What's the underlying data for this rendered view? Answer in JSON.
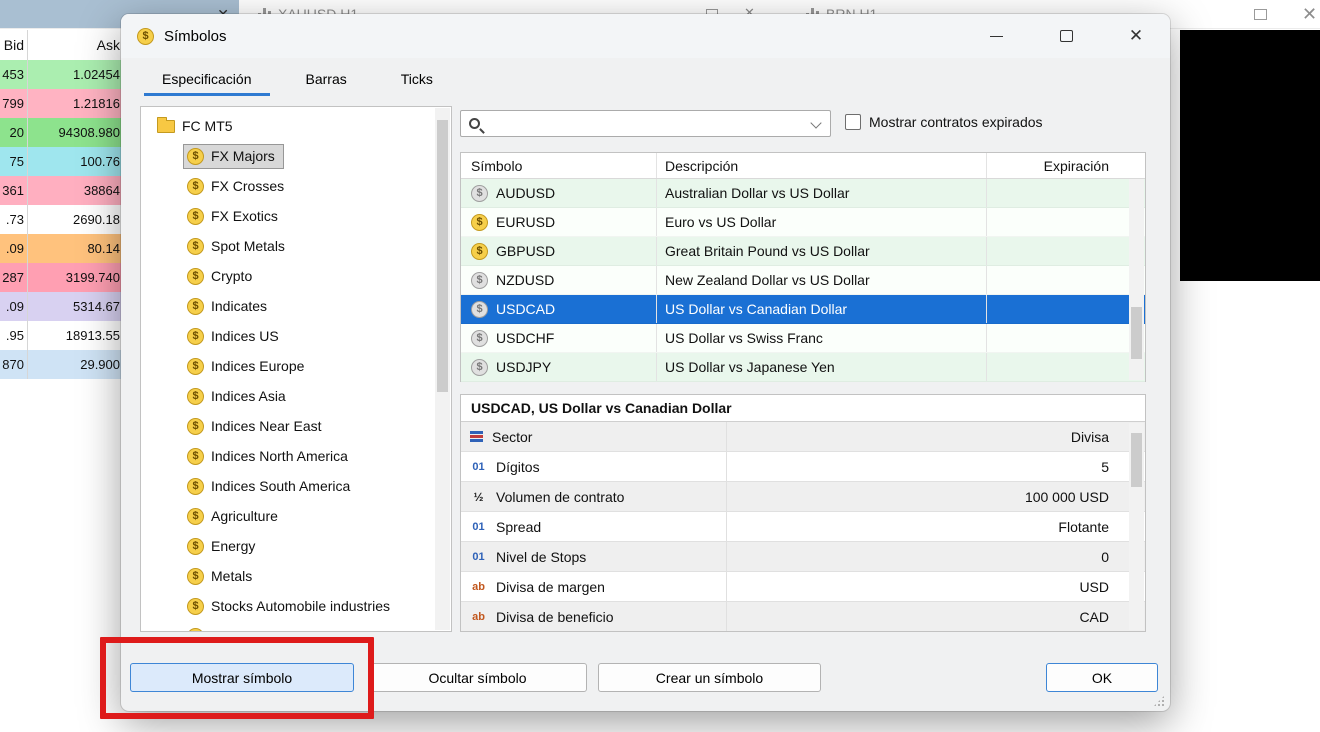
{
  "background": {
    "chart_tabs": [
      {
        "label": "XAUUSD,H1"
      },
      {
        "label": "BRN,H1"
      }
    ],
    "market_watch": {
      "headers": {
        "bid": "Bid",
        "ask": "Ask"
      },
      "rows": [
        {
          "bid": "453",
          "ask": "1.02454",
          "bg": "#abeeb0"
        },
        {
          "bid": "799",
          "ask": "1.21816",
          "bg": "#ffb3c2"
        },
        {
          "bid": "20",
          "ask": "94308.980",
          "bg": "#8de38d"
        },
        {
          "bid": "75",
          "ask": "100.76",
          "bg": "#9fe6ee"
        },
        {
          "bid": "361",
          "ask": "38864",
          "bg": "#ffafc0"
        },
        {
          "bid": ".73",
          "ask": "2690.18",
          "bg": "#ffffff"
        },
        {
          "bid": ".09",
          "ask": "80.14",
          "bg": "#ffc27d"
        },
        {
          "bid": "287",
          "ask": "3199.740",
          "bg": "#ff9fb2"
        },
        {
          "bid": ".09",
          "ask": "5314.67",
          "bg": "#d8d1f1"
        },
        {
          "bid": ".95",
          "ask": "18913.55",
          "bg": "#ffffff"
        },
        {
          "bid": "870",
          "ask": "29.900",
          "bg": "#cfe3f5"
        }
      ]
    }
  },
  "dialog": {
    "title": "Símbolos",
    "tabs": [
      {
        "label": "Especificación",
        "active": true
      },
      {
        "label": "Barras",
        "active": false
      },
      {
        "label": "Ticks",
        "active": false
      }
    ],
    "tree": {
      "root": {
        "label": "FC MT5"
      },
      "items": [
        {
          "label": "FX Majors",
          "selected": true
        },
        {
          "label": "FX Crosses",
          "selected": false
        },
        {
          "label": "FX Exotics",
          "selected": false
        },
        {
          "label": "Spot Metals",
          "selected": false
        },
        {
          "label": "Crypto",
          "selected": false
        },
        {
          "label": "Indicates",
          "selected": false
        },
        {
          "label": "Indices US",
          "selected": false
        },
        {
          "label": "Indices Europe",
          "selected": false
        },
        {
          "label": "Indices Asia",
          "selected": false
        },
        {
          "label": "Indices Near East",
          "selected": false
        },
        {
          "label": "Indices North America",
          "selected": false
        },
        {
          "label": "Indices South America",
          "selected": false
        },
        {
          "label": "Agriculture",
          "selected": false
        },
        {
          "label": "Energy",
          "selected": false
        },
        {
          "label": "Metals",
          "selected": false
        },
        {
          "label": "Stocks Automobile industries",
          "selected": false
        },
        {
          "label": "",
          "selected": false
        }
      ]
    },
    "filter": {
      "search_value": "",
      "search_placeholder": "",
      "expired_label": "Mostrar contratos expirados",
      "expired_checked": false
    },
    "symbols_table": {
      "columns": [
        "Símbolo",
        "Descripción",
        "Expiración"
      ],
      "rows": [
        {
          "symbol": "AUDUSD",
          "description": "Australian Dollar vs US Dollar",
          "expiration": "",
          "shown": false,
          "selected": false
        },
        {
          "symbol": "EURUSD",
          "description": "Euro vs US Dollar",
          "expiration": "",
          "shown": true,
          "selected": false
        },
        {
          "symbol": "GBPUSD",
          "description": "Great Britain Pound vs US Dollar",
          "expiration": "",
          "shown": true,
          "selected": false
        },
        {
          "symbol": "NZDUSD",
          "description": "New Zealand Dollar vs US Dollar",
          "expiration": "",
          "shown": false,
          "selected": false
        },
        {
          "symbol": "USDCAD",
          "description": "US Dollar vs Canadian Dollar",
          "expiration": "",
          "shown": false,
          "selected": true
        },
        {
          "symbol": "USDCHF",
          "description": "US Dollar vs Swiss Franc",
          "expiration": "",
          "shown": false,
          "selected": false
        },
        {
          "symbol": "USDJPY",
          "description": "US Dollar vs Japanese Yen",
          "expiration": "",
          "shown": false,
          "selected": false
        }
      ]
    },
    "details": {
      "title": "USDCAD, US Dollar vs Canadian Dollar",
      "rows": [
        {
          "icon": "sector-icon",
          "icon_class": "ic ic-layers",
          "glyph": "",
          "label": "Sector",
          "value": "Divisa"
        },
        {
          "icon": "digits-icon",
          "icon_class": "ic ic-num",
          "glyph": "01",
          "label": "Dígitos",
          "value": "5"
        },
        {
          "icon": "contract-size-icon",
          "icon_class": "ic ic-frac",
          "glyph": "½",
          "label": "Volumen de contrato",
          "value": "100 000 USD"
        },
        {
          "icon": "spread-icon",
          "icon_class": "ic ic-num",
          "glyph": "01",
          "label": "Spread",
          "value": "Flotante"
        },
        {
          "icon": "stops-level-icon",
          "icon_class": "ic ic-num",
          "glyph": "01",
          "label": "Nivel de Stops",
          "value": "0"
        },
        {
          "icon": "margin-currency-icon",
          "icon_class": "ic ic-ab",
          "glyph": "ab",
          "label": "Divisa de margen",
          "value": "USD"
        },
        {
          "icon": "profit-currency-icon",
          "icon_class": "ic ic-ab",
          "glyph": "ab",
          "label": "Divisa de beneficio",
          "value": "CAD"
        }
      ]
    },
    "buttons": {
      "show": "Mostrar símbolo",
      "hide": "Ocultar símbolo",
      "create": "Crear un símbolo",
      "ok": "OK"
    }
  },
  "colors": {
    "selection_blue": "#1a70d4",
    "tab_underline": "#2e7ad1",
    "annotation_red": "#de1b1b",
    "coin_yellow": "#f6cf4a"
  }
}
